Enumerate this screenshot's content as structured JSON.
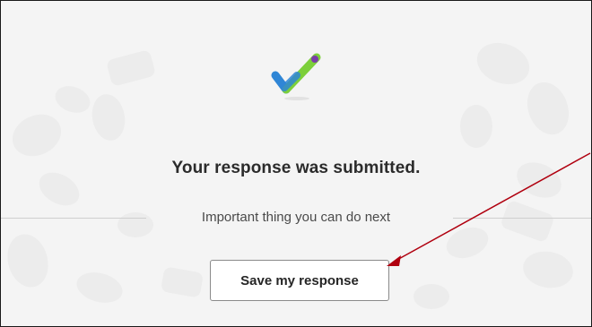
{
  "confirmation": {
    "title": "Your response was submitted.",
    "next_step_text": "Important thing you can do next",
    "save_label": "Save my response"
  },
  "icons": {
    "success": "checkmark-icon",
    "annotation": "red-arrow"
  },
  "colors": {
    "check_blue": "#2f86d6",
    "check_green": "#7ccf3a",
    "annotation_red": "#b0000f",
    "button_border": "#8a8a8a",
    "background": "#f4f4f4"
  }
}
